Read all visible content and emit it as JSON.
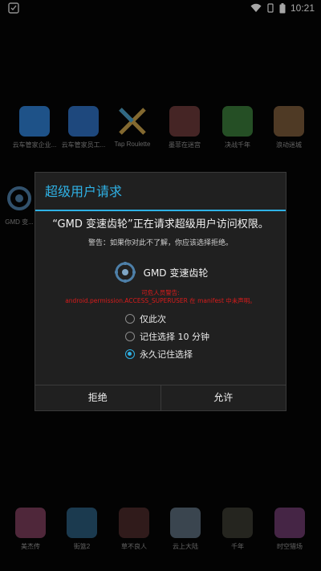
{
  "status_bar": {
    "time": "10:21"
  },
  "home_row_top": [
    {
      "label": "云车管家企业...",
      "color": "#2f7fd1"
    },
    {
      "label": "云车管家员工...",
      "color": "#2f6fc0"
    },
    {
      "label": "Tap Roulette",
      "color": "#2a2a2a"
    },
    {
      "label": "墨菲在迷宫",
      "color": "#6b3a3a"
    },
    {
      "label": "决战千年",
      "color": "#3a7a3a"
    },
    {
      "label": "浪动迷城",
      "color": "#7a5a3a"
    }
  ],
  "home_row_side": {
    "label": "GMD 变..."
  },
  "home_row_bottom": [
    {
      "label": "美杰传",
      "color": "#7a3d5a"
    },
    {
      "label": "街篮2",
      "color": "#2a5a7a"
    },
    {
      "label": "草不良人",
      "color": "#4a2a2a"
    },
    {
      "label": "云上大陆",
      "color": "#5a6a7a"
    },
    {
      "label": "千年",
      "color": "#3a3a30"
    },
    {
      "label": "时空猎场",
      "color": "#6a3a6a"
    }
  ],
  "dialog": {
    "title": "超级用户请求",
    "message": "“GMD 变速齿轮”正在请求超级用户访问权限。",
    "warning": "警告：如果你对此不了解，你应该选择拒绝。",
    "app_name": "GMD 变速齿轮",
    "red_line1": "可危人员警告:",
    "red_line2": "android.permission.ACCESS_SUPERUSER 在 manifest 中未声明。",
    "options": [
      "仅此次",
      "记住选择 10 分钟",
      "永久记住选择"
    ],
    "selected_option": 2,
    "deny_label": "拒绝",
    "allow_label": "允许",
    "accent": "#2fb2e6"
  }
}
